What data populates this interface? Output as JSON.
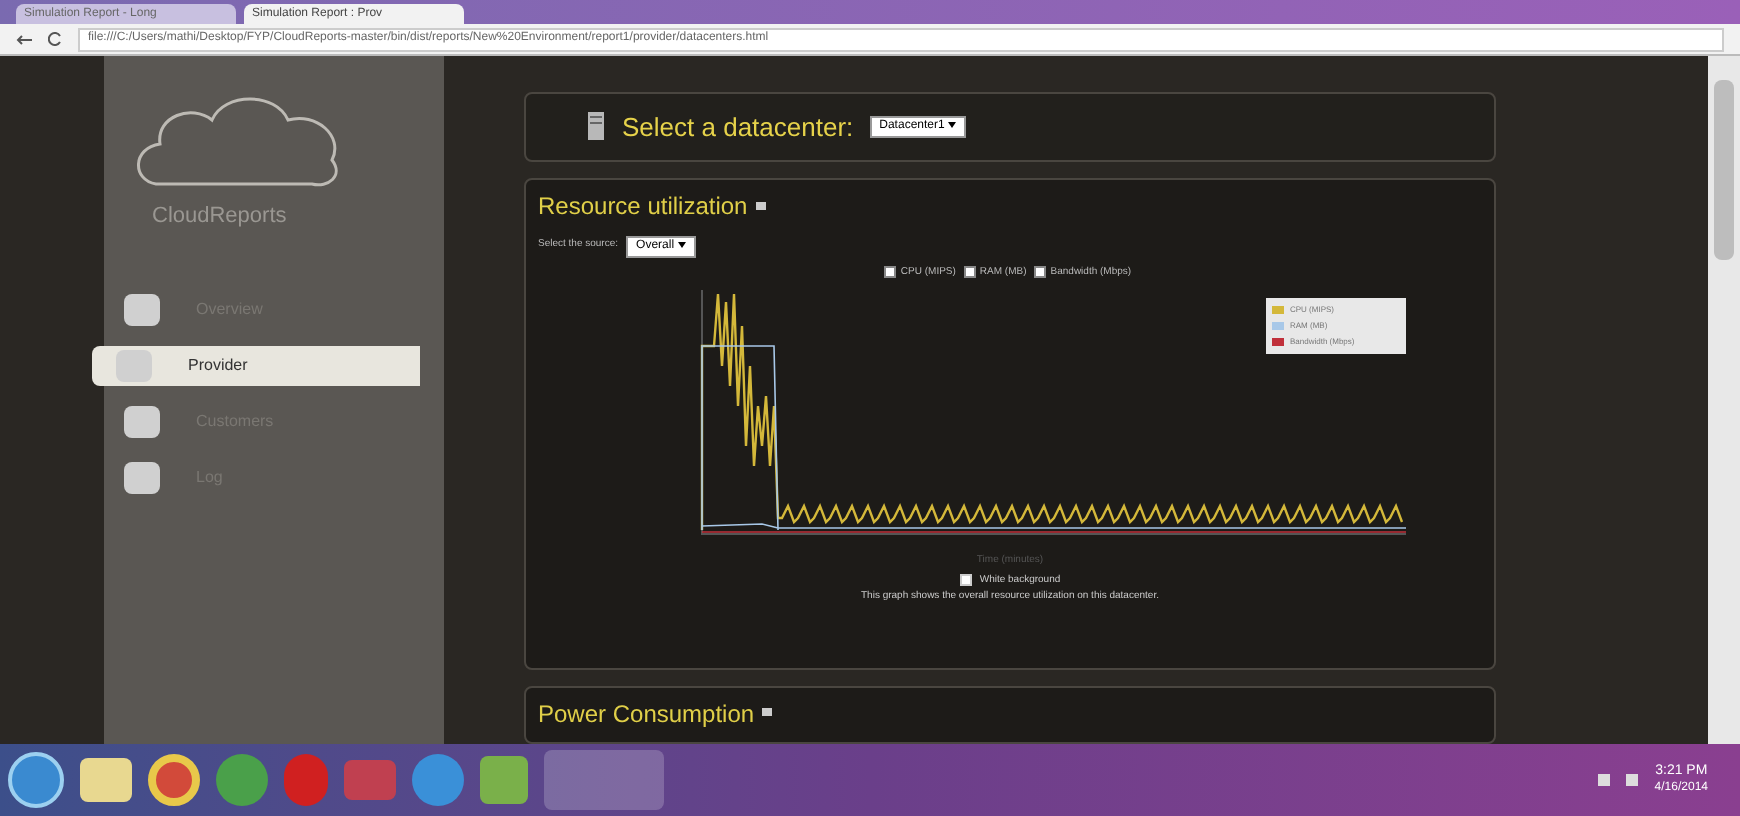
{
  "browser": {
    "tabs": [
      {
        "label": "Simulation Report - Long",
        "selected": false
      },
      {
        "label": "Simulation Report : Prov",
        "selected": true
      }
    ],
    "url": "file:///C:/Users/mathi/Desktop/FYP/CloudReports-master/bin/dist/reports/New%20Environment/report1/provider/datacenters.html"
  },
  "sidebar": {
    "logo": "CloudReports",
    "items": [
      {
        "label": "Overview",
        "selected": false
      },
      {
        "label": "Provider",
        "selected": true
      },
      {
        "label": "Customers",
        "selected": false
      },
      {
        "label": "Log",
        "selected": false
      }
    ]
  },
  "datacenter": {
    "label": "Select a datacenter:",
    "value": "Datacenter1"
  },
  "resource_panel": {
    "title": "Resource utilization",
    "source_label": "Select the source:",
    "source_value": "Overall",
    "series": [
      {
        "label": "CPU (MIPS)",
        "checked": true
      },
      {
        "label": "RAM (MB)",
        "checked": true
      },
      {
        "label": "Bandwidth (Mbps)",
        "checked": true
      }
    ],
    "legend": [
      {
        "label": "CPU (MIPS)",
        "color": "#d4b83a"
      },
      {
        "label": "RAM (MB)",
        "color": "#a8c8e8"
      },
      {
        "label": "Bandwidth (Mbps)",
        "color": "#c0303a"
      }
    ],
    "xlabel": "Time (minutes)",
    "white_background": {
      "label": "White background",
      "checked": false
    },
    "caption": "This graph shows the overall resource utilization on this datacenter."
  },
  "power_panel": {
    "title": "Power Consumption"
  },
  "taskbar": {
    "time": "3:21 PM",
    "date": "4/16/2014"
  }
}
